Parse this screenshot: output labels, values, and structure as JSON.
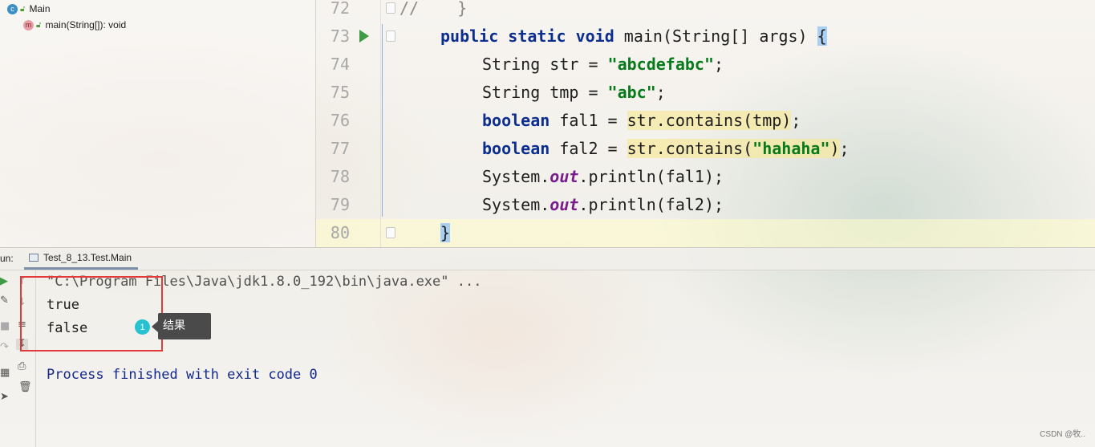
{
  "structure": {
    "items": [
      {
        "icon": "class-icon",
        "icon_glyph": "c",
        "label": "Main"
      },
      {
        "icon": "method-icon",
        "icon_glyph": "m",
        "label": "main(String[]): void"
      }
    ]
  },
  "editor": {
    "line_numbers": [
      "72",
      "73",
      "74",
      "75",
      "76",
      "77",
      "78",
      "79",
      "80"
    ],
    "lines": {
      "l72": {
        "comment": "//    }"
      },
      "l73": {
        "kw1": "public",
        "kw2": "static",
        "kw3": "void",
        "rest": " main(String[] args) ",
        "brace": "{"
      },
      "l74": {
        "lead": "String str = ",
        "string": "\"abcdefabc\"",
        "tail": ";"
      },
      "l75": {
        "lead": "String tmp = ",
        "string": "\"abc\"",
        "tail": ";"
      },
      "l76": {
        "kw": "boolean",
        "lead": " fal1 = ",
        "hl": "str.contains(tmp)",
        "tail": ";"
      },
      "l77": {
        "kw": "boolean",
        "lead": " fal2 = ",
        "hl_a": "str.contains(",
        "string": "\"hahaha\"",
        "hl_b": ")",
        "tail": ";"
      },
      "l78": {
        "lead": "System.",
        "field": "out",
        "tail": ".println(fal1);"
      },
      "l79": {
        "lead": "System.",
        "field": "out",
        "tail": ".println(fal2);"
      },
      "l80": {
        "brace": "}"
      }
    }
  },
  "run_panel": {
    "label": "un:",
    "tab_label": "Test_8_13.Test.Main",
    "console_lines": [
      "\"C:\\Program Files\\Java\\jdk1.8.0_192\\bin\\java.exe\" ...",
      "true",
      "false",
      "Process finished with exit code 0"
    ],
    "annotation_badge": "1",
    "annotation_text": "结果"
  },
  "watermark": "CSDN @牧..",
  "colors": {
    "keyword": "#0b2e8f",
    "string": "#077a1c",
    "field": "#7a1d8c",
    "annotation_border": "#e23a3a",
    "badge": "#27c1d0"
  }
}
